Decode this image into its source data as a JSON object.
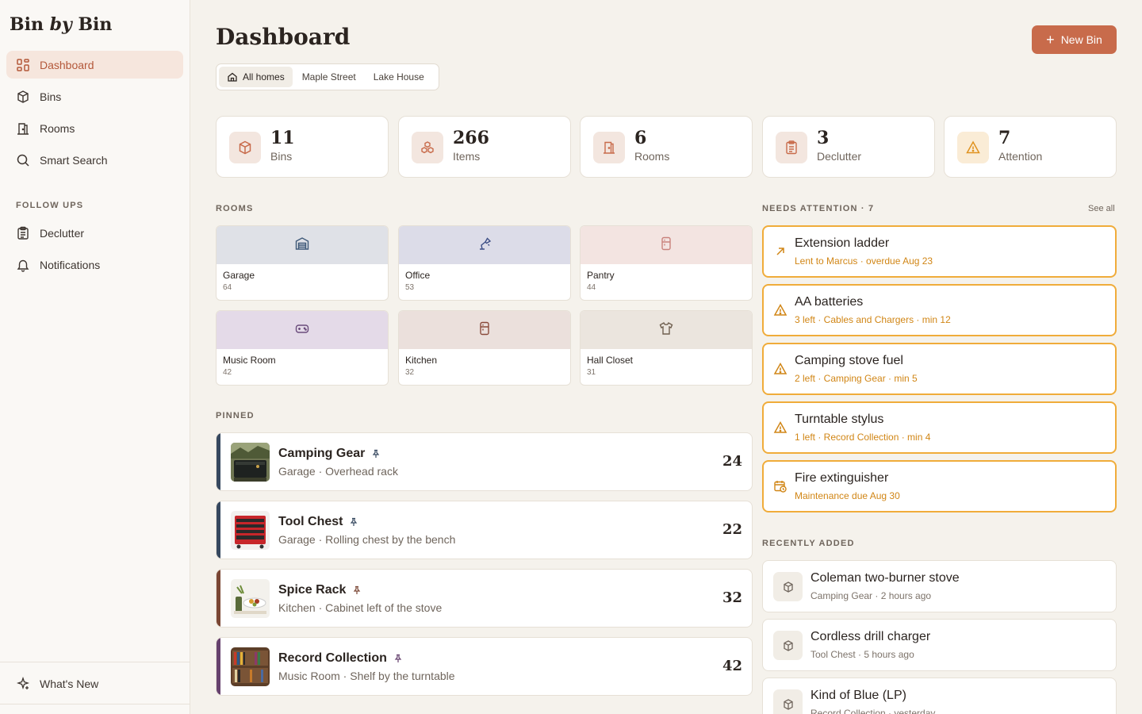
{
  "brand": {
    "part1": "Bin ",
    "part2": "by",
    "part3": " Bin"
  },
  "nav": {
    "dashboard": "Dashboard",
    "bins": "Bins",
    "rooms": "Rooms",
    "smart_search": "Smart Search",
    "follow_ups_heading": "FOLLOW UPS",
    "declutter": "Declutter",
    "notifications": "Notifications",
    "whats_new": "What's New"
  },
  "header": {
    "title": "Dashboard",
    "new_bin": "New Bin"
  },
  "home_tabs": [
    "All homes",
    "Maple Street",
    "Lake House"
  ],
  "stats": [
    {
      "value": "11",
      "label": "Bins",
      "icon": "box-icon"
    },
    {
      "value": "266",
      "label": "Items",
      "icon": "items-icon"
    },
    {
      "value": "6",
      "label": "Rooms",
      "icon": "door-icon"
    },
    {
      "value": "3",
      "label": "Declutter",
      "icon": "clipboard-icon"
    },
    {
      "value": "7",
      "label": "Attention",
      "icon": "warning-icon"
    }
  ],
  "sections": {
    "rooms": "ROOMS",
    "needs_attention": "NEEDS ATTENTION · 7",
    "see_all": "See all",
    "pinned": "PINNED",
    "recently_added": "RECENTLY ADDED"
  },
  "colors": {
    "accent": "#c86b4b",
    "attention": "#f0ac3a",
    "attention_text": "#d18616"
  },
  "rooms": [
    {
      "name": "Garage",
      "count": "64",
      "icon": "garage-icon",
      "color": "#dfe1e7"
    },
    {
      "name": "Office",
      "count": "53",
      "icon": "lamp-icon",
      "color": "#dcdce8"
    },
    {
      "name": "Pantry",
      "count": "44",
      "icon": "fridge-icon",
      "color": "#f3e4e1"
    },
    {
      "name": "Music Room",
      "count": "42",
      "icon": "gamepad-icon",
      "color": "#e4dae8"
    },
    {
      "name": "Kitchen",
      "count": "32",
      "icon": "fridge-icon",
      "color": "#ebe0dc"
    },
    {
      "name": "Hall Closet",
      "count": "31",
      "icon": "shirt-icon",
      "color": "#ebe5de"
    }
  ],
  "pinned": [
    {
      "title": "Camping Gear",
      "sub": "Garage · Overhead rack",
      "count": "24",
      "stripe": "#36485f"
    },
    {
      "title": "Tool Chest",
      "sub": "Garage · Rolling chest by the bench",
      "count": "22",
      "stripe": "#36485f"
    },
    {
      "title": "Spice Rack",
      "sub": "Kitchen · Cabinet left of the stove",
      "count": "32",
      "stripe": "#7a4634"
    },
    {
      "title": "Record Collection",
      "sub": "Music Room · Shelf by the turntable",
      "count": "42",
      "stripe": "#66416e"
    }
  ],
  "attention": [
    {
      "title": "Extension ladder",
      "sub": "Lent to Marcus · overdue Aug 23",
      "icon": "arrow-up-right-icon"
    },
    {
      "title": "AA batteries",
      "sub": "3 left · Cables and Chargers · min 12",
      "icon": "warning-icon"
    },
    {
      "title": "Camping stove fuel",
      "sub": "2 left · Camping Gear · min 5",
      "icon": "warning-icon"
    },
    {
      "title": "Turntable stylus",
      "sub": "1 left · Record Collection · min 4",
      "icon": "warning-icon"
    },
    {
      "title": "Fire extinguisher",
      "sub": "Maintenance due Aug 30",
      "icon": "calendar-clock-icon"
    }
  ],
  "recent": [
    {
      "title": "Coleman two-burner stove",
      "sub": "Camping Gear · 2 hours ago"
    },
    {
      "title": "Cordless drill charger",
      "sub": "Tool Chest · 5 hours ago"
    },
    {
      "title": "Kind of Blue (LP)",
      "sub": "Record Collection · yesterday"
    }
  ]
}
